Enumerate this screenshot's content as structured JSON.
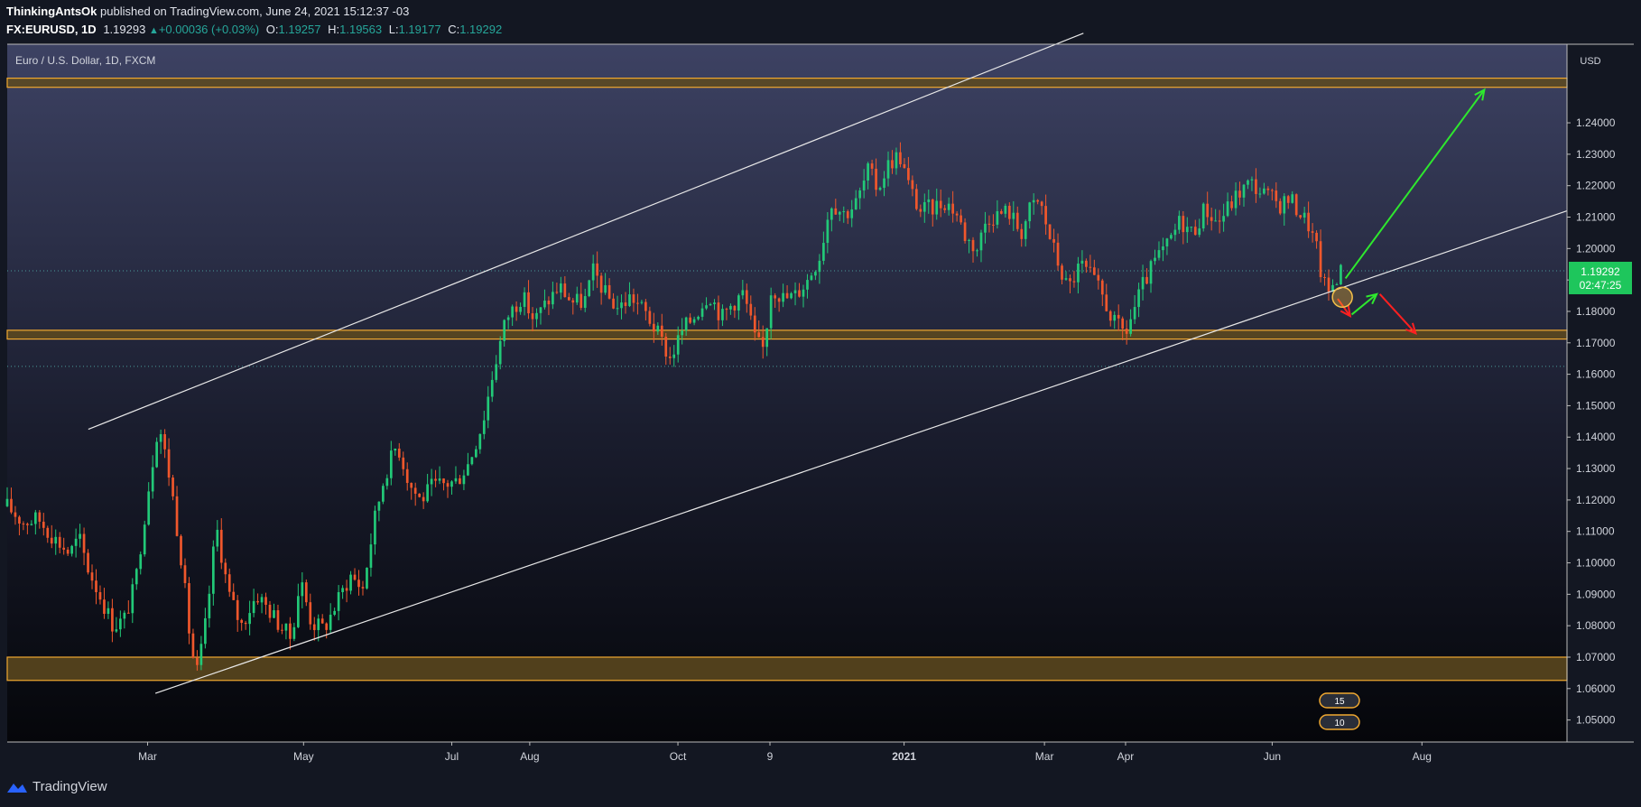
{
  "header": {
    "author": "ThinkingAntsOk",
    "published_text": "published on TradingView.com, June 24, 2021 15:12:37 -03",
    "symbol": "FX:EURUSD, 1D",
    "last": "1.19293",
    "change": "+0.00036 (+0.03%)",
    "o_label": "O:",
    "o_value": "1.19257",
    "h_label": "H:",
    "h_value": "1.19563",
    "l_label": "L:",
    "l_value": "1.19177",
    "c_label": "C:",
    "c_value": "1.19292"
  },
  "footer": {
    "brand": "TradingView",
    "icon": "tradingview-logo-icon"
  },
  "colors": {
    "up": "#26a69a",
    "up_candle": "#22c978",
    "down": "#f0572c",
    "zone_fill": "#5e4a1f",
    "zone_border": "#f0a830",
    "arrow_up": "#2ee82e",
    "arrow_down": "#ff2020",
    "price_label_bg": "#1ec65c"
  },
  "chart_data": {
    "type": "candlestick",
    "title": "Euro / U.S. Dollar, 1D, FXCM",
    "currency": "USD",
    "ylim": [
      1.043,
      1.265
    ],
    "y_ticks": [
      "1.05000",
      "1.06000",
      "1.07000",
      "1.08000",
      "1.09000",
      "1.10000",
      "1.11000",
      "1.12000",
      "1.13000",
      "1.14000",
      "1.15000",
      "1.16000",
      "1.17000",
      "1.18000",
      "1.19000",
      "1.20000",
      "1.21000",
      "1.22000",
      "1.23000",
      "1.24000"
    ],
    "x_ticks": [
      "Mar",
      "May",
      "Jul",
      "Aug",
      "Oct",
      "9",
      "2021",
      "Mar",
      "Apr",
      "Jun",
      "Aug"
    ],
    "x_tick_pos": [
      0.09,
      0.19,
      0.285,
      0.335,
      0.43,
      0.489,
      0.575,
      0.665,
      0.717,
      0.811,
      0.907
    ],
    "price_label": "1.19292",
    "countdown": "02:47:25",
    "last_price": 1.19292,
    "dotted_lines": [
      1.1929,
      1.1625
    ],
    "zones": [
      {
        "low": 1.2513,
        "high": 1.2542
      },
      {
        "low": 1.1712,
        "high": 1.174
      },
      {
        "low": 1.0626,
        "high": 1.07
      }
    ],
    "channel": {
      "upper": [
        [
          0.052,
          1.1425
        ],
        [
          0.69,
          1.2685
        ]
      ],
      "lower": [
        [
          0.095,
          1.0585
        ],
        [
          1.0,
          1.212
        ]
      ]
    },
    "anchors": [
      [
        0.0,
        1.118
      ],
      [
        0.01,
        1.113
      ],
      [
        0.02,
        1.114
      ],
      [
        0.03,
        1.108
      ],
      [
        0.04,
        1.103
      ],
      [
        0.046,
        1.108
      ],
      [
        0.052,
        1.098
      ],
      [
        0.06,
        1.089
      ],
      [
        0.068,
        1.08
      ],
      [
        0.075,
        1.082
      ],
      [
        0.082,
        1.093
      ],
      [
        0.09,
        1.122
      ],
      [
        0.097,
        1.145
      ],
      [
        0.105,
        1.125
      ],
      [
        0.112,
        1.1
      ],
      [
        0.118,
        1.072
      ],
      [
        0.122,
        1.065
      ],
      [
        0.128,
        1.083
      ],
      [
        0.134,
        1.112
      ],
      [
        0.142,
        1.09
      ],
      [
        0.15,
        1.08
      ],
      [
        0.16,
        1.09
      ],
      [
        0.168,
        1.085
      ],
      [
        0.175,
        1.08
      ],
      [
        0.182,
        1.076
      ],
      [
        0.188,
        1.095
      ],
      [
        0.195,
        1.081
      ],
      [
        0.203,
        1.079
      ],
      [
        0.212,
        1.088
      ],
      [
        0.22,
        1.096
      ],
      [
        0.228,
        1.092
      ],
      [
        0.236,
        1.115
      ],
      [
        0.242,
        1.128
      ],
      [
        0.25,
        1.138
      ],
      [
        0.258,
        1.125
      ],
      [
        0.265,
        1.12
      ],
      [
        0.272,
        1.124
      ],
      [
        0.28,
        1.125
      ],
      [
        0.288,
        1.126
      ],
      [
        0.296,
        1.132
      ],
      [
        0.305,
        1.145
      ],
      [
        0.312,
        1.162
      ],
      [
        0.32,
        1.178
      ],
      [
        0.33,
        1.185
      ],
      [
        0.338,
        1.177
      ],
      [
        0.346,
        1.183
      ],
      [
        0.354,
        1.188
      ],
      [
        0.362,
        1.183
      ],
      [
        0.37,
        1.183
      ],
      [
        0.376,
        1.193
      ],
      [
        0.384,
        1.185
      ],
      [
        0.392,
        1.181
      ],
      [
        0.4,
        1.185
      ],
      [
        0.41,
        1.179
      ],
      [
        0.418,
        1.172
      ],
      [
        0.425,
        1.165
      ],
      [
        0.433,
        1.174
      ],
      [
        0.441,
        1.179
      ],
      [
        0.45,
        1.186
      ],
      [
        0.458,
        1.178
      ],
      [
        0.464,
        1.182
      ],
      [
        0.472,
        1.186
      ],
      [
        0.48,
        1.17
      ],
      [
        0.485,
        1.168
      ],
      [
        0.49,
        1.188
      ],
      [
        0.498,
        1.184
      ],
      [
        0.505,
        1.185
      ],
      [
        0.513,
        1.19
      ],
      [
        0.521,
        1.198
      ],
      [
        0.528,
        1.215
      ],
      [
        0.537,
        1.211
      ],
      [
        0.545,
        1.215
      ],
      [
        0.552,
        1.225
      ],
      [
        0.558,
        1.219
      ],
      [
        0.565,
        1.227
      ],
      [
        0.572,
        1.23
      ],
      [
        0.578,
        1.22
      ],
      [
        0.585,
        1.212
      ],
      [
        0.593,
        1.213
      ],
      [
        0.601,
        1.215
      ],
      [
        0.608,
        1.212
      ],
      [
        0.615,
        1.203
      ],
      [
        0.622,
        1.2
      ],
      [
        0.628,
        1.21
      ],
      [
        0.636,
        1.211
      ],
      [
        0.642,
        1.212
      ],
      [
        0.65,
        1.205
      ],
      [
        0.656,
        1.213
      ],
      [
        0.662,
        1.215
      ],
      [
        0.667,
        1.206
      ],
      [
        0.674,
        1.195
      ],
      [
        0.68,
        1.187
      ],
      [
        0.688,
        1.195
      ],
      [
        0.695,
        1.191
      ],
      [
        0.702,
        1.185
      ],
      [
        0.71,
        1.176
      ],
      [
        0.717,
        1.173
      ],
      [
        0.722,
        1.18
      ],
      [
        0.728,
        1.188
      ],
      [
        0.736,
        1.196
      ],
      [
        0.744,
        1.201
      ],
      [
        0.752,
        1.209
      ],
      [
        0.76,
        1.205
      ],
      [
        0.768,
        1.213
      ],
      [
        0.776,
        1.208
      ],
      [
        0.784,
        1.214
      ],
      [
        0.79,
        1.218
      ],
      [
        0.797,
        1.221
      ],
      [
        0.804,
        1.218
      ],
      [
        0.81,
        1.216
      ],
      [
        0.816,
        1.214
      ],
      [
        0.822,
        1.216
      ],
      [
        0.828,
        1.212
      ],
      [
        0.834,
        1.208
      ],
      [
        0.84,
        1.199
      ],
      [
        0.843,
        1.19
      ],
      [
        0.847,
        1.186
      ],
      [
        0.852,
        1.191
      ],
      [
        0.855,
        1.1928
      ]
    ],
    "arrows": {
      "up_long": [
        [
          0.858,
          1.1905
        ],
        [
          0.947,
          1.2505
        ]
      ],
      "up_short": [
        [
          0.862,
          1.179
        ],
        [
          0.878,
          1.1855
        ]
      ],
      "down_a": [
        [
          0.853,
          1.184
        ],
        [
          0.861,
          1.1785
        ]
      ],
      "down_b": [
        [
          0.88,
          1.1855
        ],
        [
          0.903,
          1.173
        ]
      ]
    },
    "circle": [
      0.856,
      1.1845
    ]
  }
}
